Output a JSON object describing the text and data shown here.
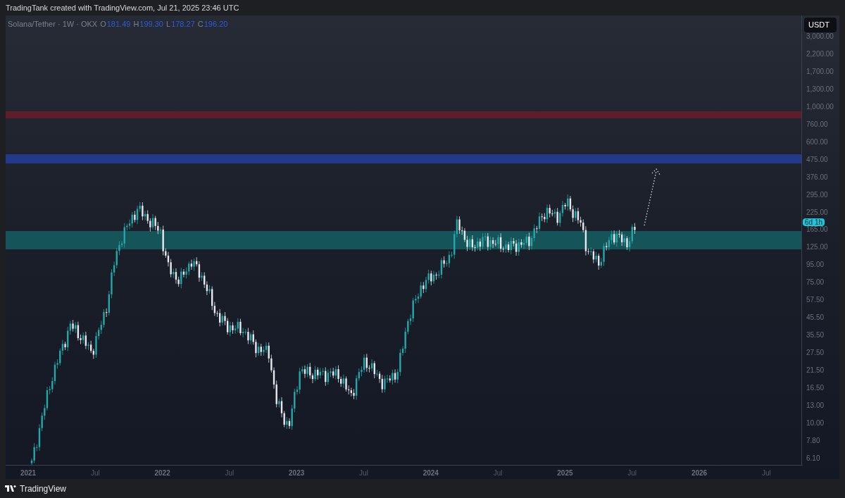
{
  "header": {
    "text": "TradingTank created with TradingView.com, Jul 21, 2025 23:46 UTC"
  },
  "legend": {
    "symbol": "Solana/Tether · 1W · OKX",
    "values": [
      {
        "key": "O",
        "value": "181.49"
      },
      {
        "key": "H",
        "value": "199.30"
      },
      {
        "key": "L",
        "value": "178.27"
      },
      {
        "key": "C",
        "value": "196.20"
      }
    ]
  },
  "price_axis": {
    "currency": "USDT",
    "labels": [
      "3,000.00",
      "2,200.00",
      "1,700.00",
      "1,300.00",
      "1,000.00",
      "760.00",
      "600.00",
      "475.00",
      "376.00",
      "295.00",
      "225.00",
      "165.00",
      "125.00",
      "95.00",
      "75.00",
      "57.50",
      "45.50",
      "35.50",
      "27.50",
      "21.50",
      "16.50",
      "13.00",
      "10.00",
      "7.80",
      "6.10"
    ],
    "countdown": "6d 1h"
  },
  "zones": [
    {
      "color": "#5c1f2a"
    },
    {
      "color": "#25398a"
    },
    {
      "color": "#155458"
    }
  ],
  "time_axis": [
    {
      "label": "2021",
      "kind": "year"
    },
    {
      "label": "Jul",
      "kind": "month"
    },
    {
      "label": "2022",
      "kind": "year"
    },
    {
      "label": "Jul",
      "kind": "month"
    },
    {
      "label": "2023",
      "kind": "year"
    },
    {
      "label": "Jul",
      "kind": "month"
    },
    {
      "label": "2024",
      "kind": "year"
    },
    {
      "label": "Jul",
      "kind": "month"
    },
    {
      "label": "2025",
      "kind": "year"
    },
    {
      "label": "Jul",
      "kind": "month"
    },
    {
      "label": "2026",
      "kind": "year"
    },
    {
      "label": "Jul",
      "kind": "month"
    }
  ],
  "footer": {
    "brand": "TradingView"
  }
}
